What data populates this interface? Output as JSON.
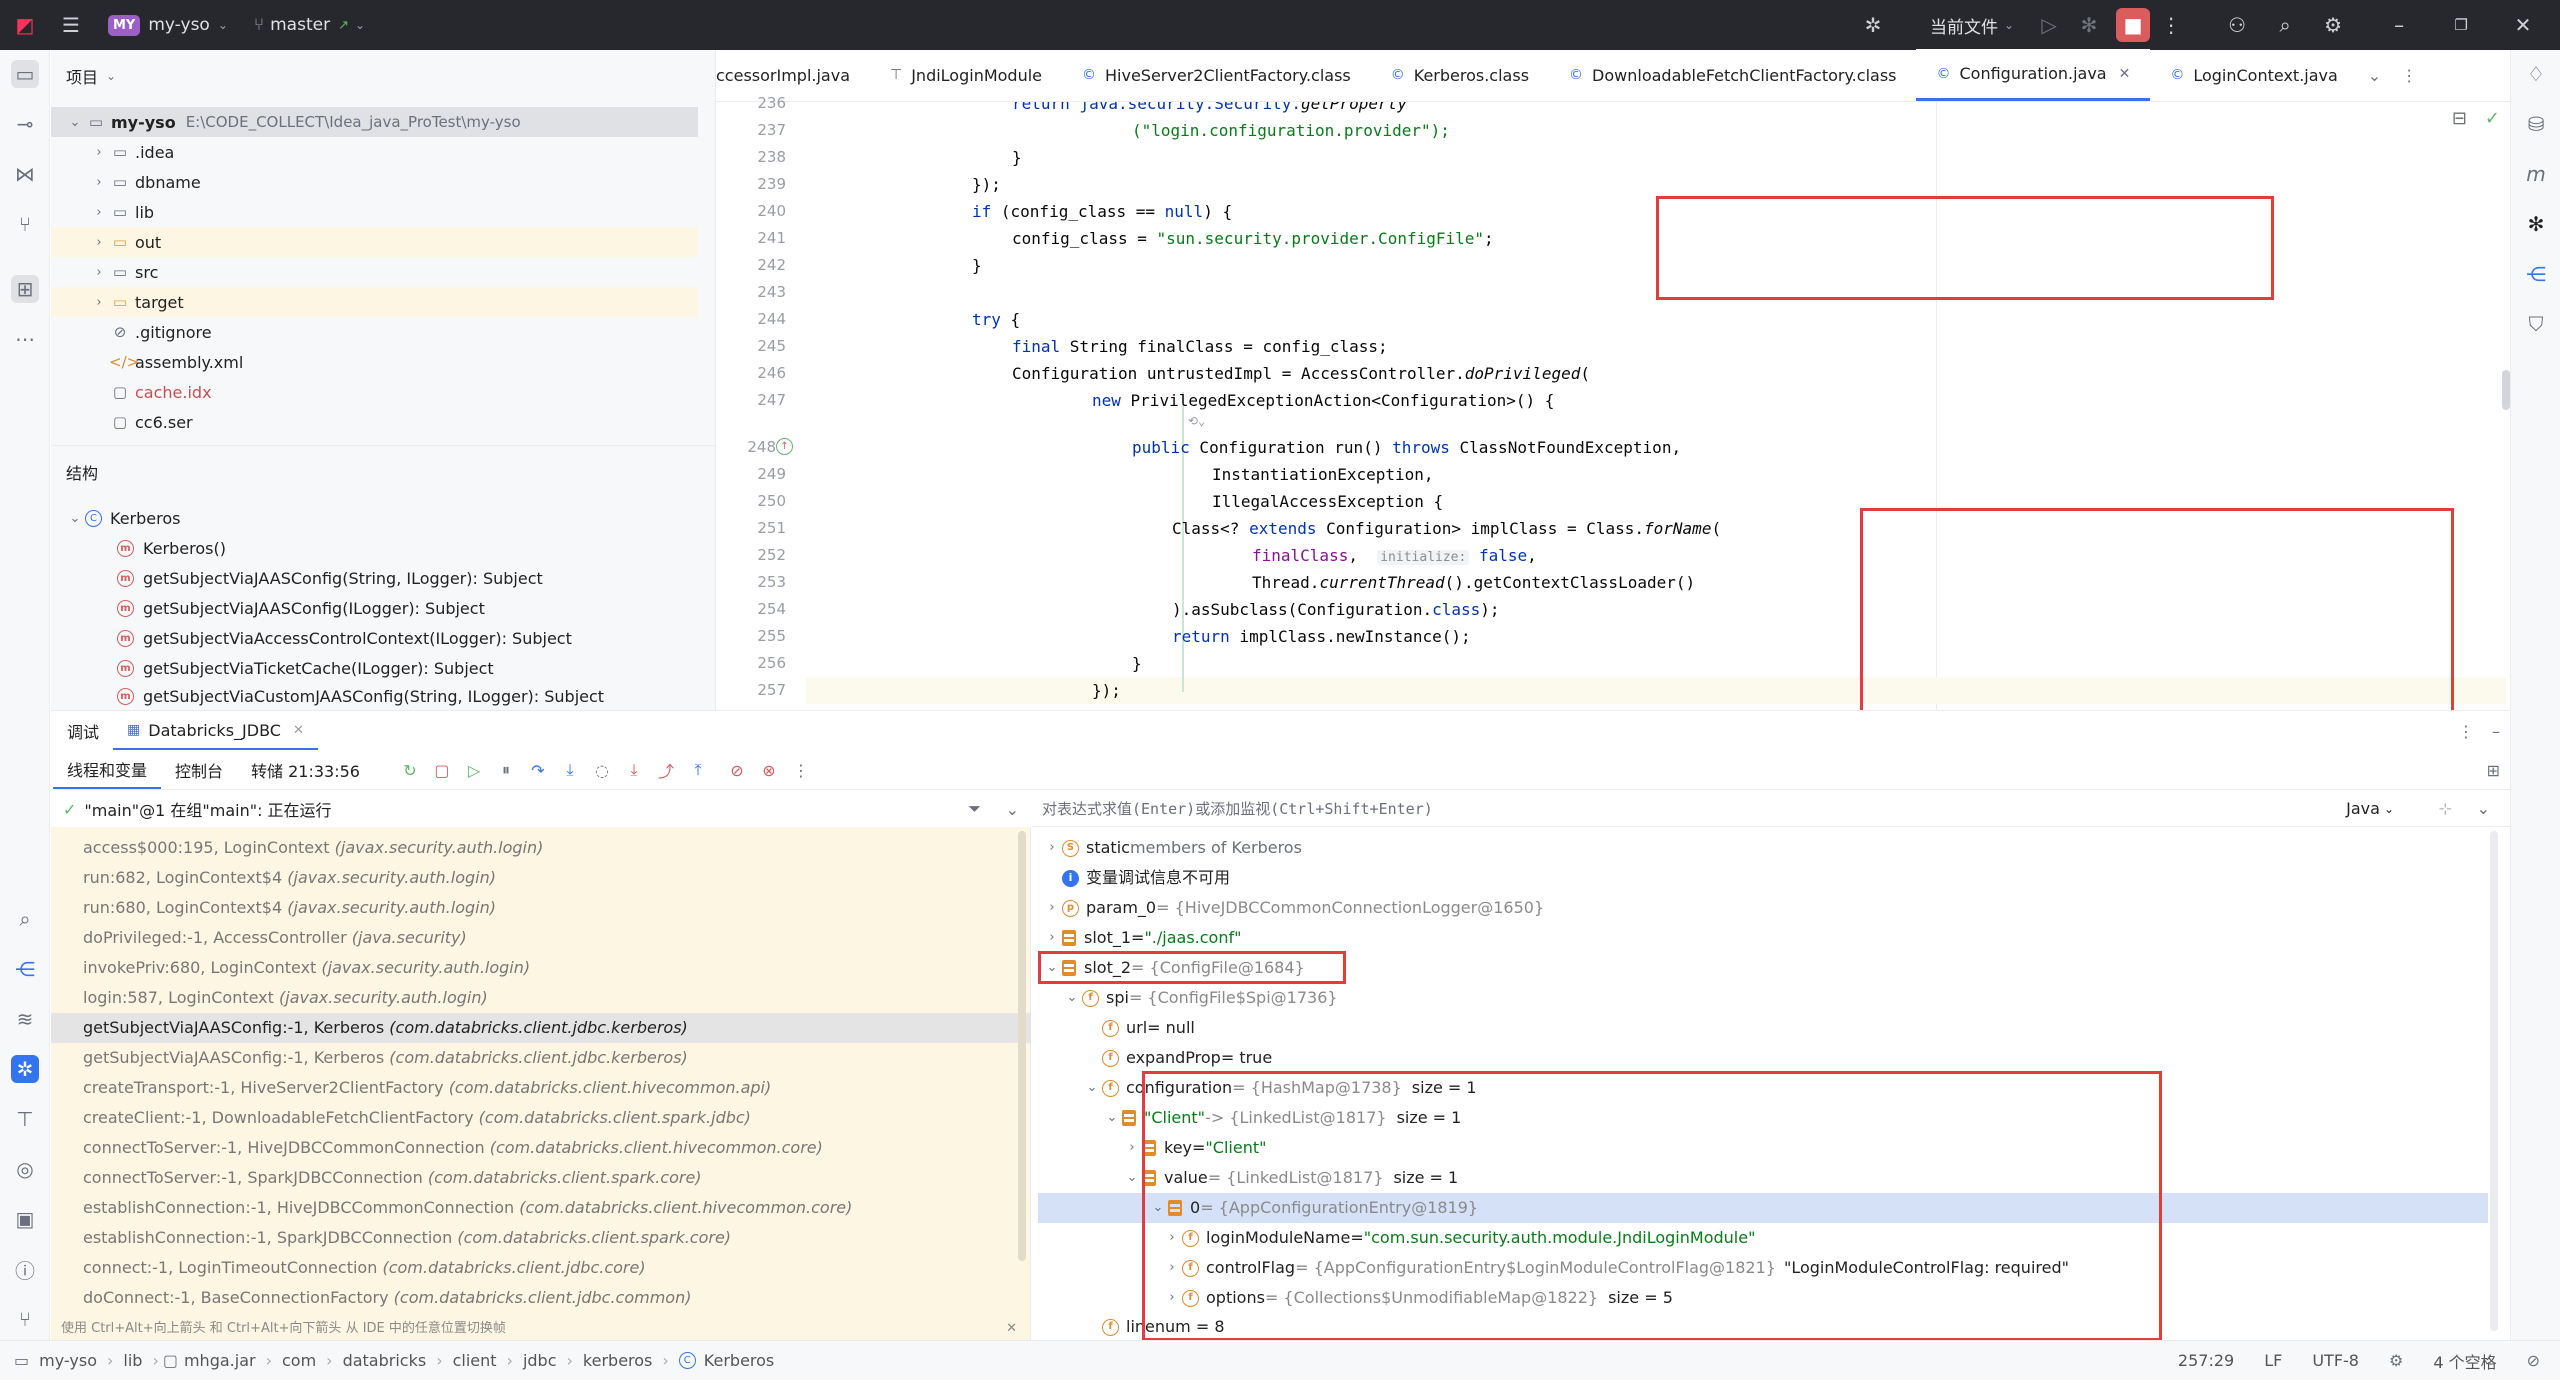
{
  "titlebar": {
    "project_badge": "MY",
    "project_name": "my-yso",
    "branch": "master",
    "run_config": "当前文件"
  },
  "project_panel": {
    "title": "项目",
    "root_name": "my-yso",
    "root_path": "E:\\CODE_COLLECT\\Idea_java_ProTest\\my-yso",
    "items": [
      {
        "label": ".idea"
      },
      {
        "label": "dbname"
      },
      {
        "label": "lib"
      },
      {
        "label": "out"
      },
      {
        "label": "src"
      },
      {
        "label": "target"
      },
      {
        "label": ".gitignore"
      },
      {
        "label": "assembly.xml"
      },
      {
        "label": "cache.idx"
      },
      {
        "label": "cc6.ser"
      }
    ]
  },
  "structure_panel": {
    "title": "结构",
    "class_name": "Kerberos",
    "members": [
      "Kerberos()",
      "getSubjectViaJAASConfig(String, ILogger): Subject",
      "getSubjectViaJAASConfig(ILogger): Subject",
      "getSubjectViaAccessControlContext(ILogger): Subject",
      "getSubjectViaTicketCache(ILogger): Subject",
      "getSubjectViaCustomJAASConfig(String, ILogger): Subject"
    ]
  },
  "editor_tabs": [
    "ccessorImpl.java",
    "JndiLoginModule",
    "HiveServer2ClientFactory.class",
    "Kerberos.class",
    "DownloadableFetchClientFactory.class",
    "Configuration.java",
    "LoginContext.java"
  ],
  "code": {
    "line_numbers": [
      "236",
      "237",
      "238",
      "239",
      "240",
      "241",
      "242",
      "243",
      "244",
      "245",
      "246",
      "247",
      "248",
      "249",
      "250",
      "251",
      "252",
      "253",
      "254",
      "255",
      "256",
      "257"
    ],
    "l236_a": "return java.security.Security.",
    "l236_b": "getProperty",
    "l237": "(\"login.configuration.provider\");",
    "l238": "}",
    "l239": "});",
    "l240_kw": "if",
    "l240_rest": " (config_class == ",
    "l240_null": "null",
    "l240_end": ") {",
    "l241_a": "config_class = ",
    "l241_str": "\"sun.security.provider.ConfigFile\"",
    "l241_end": ";",
    "l242": "}",
    "l244_kw": "try",
    "l244_end": " {",
    "l245_kw": "final",
    "l245_rest": " String finalClass = config_class;",
    "l246_a": "Configuration untrustedImpl = AccessController.",
    "l246_b": "doPrivileged",
    "l246_c": "(",
    "l247_kw": "new",
    "l247_rest": " PrivilegedExceptionAction<Configuration>() {",
    "l248_kw1": "public",
    "l248_a": " Configuration run() ",
    "l248_kw2": "throws",
    "l248_b": " ClassNotFoundException,",
    "l249": "InstantiationException,",
    "l250": "IllegalAccessException {",
    "l251_a": "Class<? ",
    "l251_kw": "extends",
    "l251_b": " Configuration> implClass = Class.",
    "l251_c": "forName",
    "l251_d": "(",
    "l252_fld": "finalClass",
    "l252_comma": ",",
    "l252_hint": "initialize:",
    "l252_false": "false",
    "l253_a": "Thread.",
    "l253_b": "currentThread",
    "l253_c": "().getContextClassLoader()",
    "l254_a": ").asSubclass(Configuration.",
    "l254_kw": "class",
    "l254_b": ");",
    "l255_kw": "return",
    "l255_rest": " implClass.newInstance();",
    "l256": "}",
    "l257": "});"
  },
  "debug": {
    "tab_debug": "调试",
    "session": "Databricks_JDBC",
    "sub_tabs": [
      "线程和变量",
      "控制台",
      "转储 21:33:56"
    ],
    "thread": "\"main\"@1 在组\"main\": 正在运行",
    "eval_placeholder": "对表达式求值(Enter)或添加监视(Ctrl+Shift+Enter)",
    "lang": "Java",
    "frames": [
      {
        "m": "access$000:195, LoginContext",
        "p": "(javax.security.auth.login)"
      },
      {
        "m": "run:682, LoginContext$4",
        "p": "(javax.security.auth.login)"
      },
      {
        "m": "run:680, LoginContext$4",
        "p": "(javax.security.auth.login)"
      },
      {
        "m": "doPrivileged:-1, AccessController",
        "p": "(java.security)"
      },
      {
        "m": "invokePriv:680, LoginContext",
        "p": "(javax.security.auth.login)"
      },
      {
        "m": "login:587, LoginContext",
        "p": "(javax.security.auth.login)"
      },
      {
        "m": "getSubjectViaJAASConfig:-1, Kerberos",
        "p": "(com.databricks.client.jdbc.kerberos)"
      },
      {
        "m": "getSubjectViaJAASConfig:-1, Kerberos",
        "p": "(com.databricks.client.jdbc.kerberos)"
      },
      {
        "m": "createTransport:-1, HiveServer2ClientFactory",
        "p": "(com.databricks.client.hivecommon.api)"
      },
      {
        "m": "createClient:-1, DownloadableFetchClientFactory",
        "p": "(com.databricks.client.spark.jdbc)"
      },
      {
        "m": "connectToServer:-1, HiveJDBCCommonConnection",
        "p": "(com.databricks.client.hivecommon.core)"
      },
      {
        "m": "connectToServer:-1, SparkJDBCConnection",
        "p": "(com.databricks.client.spark.core)"
      },
      {
        "m": "establishConnection:-1, HiveJDBCCommonConnection",
        "p": "(com.databricks.client.hivecommon.core)"
      },
      {
        "m": "establishConnection:-1, SparkJDBCConnection",
        "p": "(com.databricks.client.spark.core)"
      },
      {
        "m": "connect:-1, LoginTimeoutConnection",
        "p": "(com.databricks.client.jdbc.core)"
      },
      {
        "m": "doConnect:-1, BaseConnectionFactory",
        "p": "(com.databricks.client.jdbc.common)"
      }
    ],
    "frames_hint": "使用 Ctrl+Alt+向上箭头 和 Ctrl+Alt+向下箭头 从 IDE 中的任意位置切换帧",
    "vars": {
      "static_kw": "static",
      "static_rest": " members of Kerberos",
      "no_info": "变量调试信息不可用",
      "param0_name": "param_0",
      "param0_val": " = {HiveJDBCCommonConnectionLogger@1650}",
      "slot1_name": "slot_1",
      "slot1_eq": " = ",
      "slot1_val": "\"./jaas.conf\"",
      "slot2_name": "slot_2",
      "slot2_val": " = {ConfigFile@1684}",
      "spi_name": "spi",
      "spi_val": " = {ConfigFile$Spi@1736}",
      "url_name": "url",
      "url_val": " = null",
      "expand_name": "expandProp",
      "expand_val": " = true",
      "conf_name": "configuration",
      "conf_val": " = {HashMap@1738}",
      "conf_size": "size = 1",
      "client_name": "\"Client\"",
      "client_val": " -> {LinkedList@1817}",
      "client_size": "size = 1",
      "key_name": "key",
      "key_eq": " = ",
      "key_val": "\"Client\"",
      "value_name": "value",
      "value_val": " = {LinkedList@1817}",
      "value_size": "size = 1",
      "zero_name": "0",
      "zero_val": " = {AppConfigurationEntry@1819}",
      "lmn_name": "loginModuleName",
      "lmn_eq": " = ",
      "lmn_val": "\"com.sun.security.auth.module.JndiLoginModule\"",
      "cf_name": "controlFlag",
      "cf_val": " = {AppConfigurationEntry$LoginModuleControlFlag@1821}",
      "cf_str": "\"LoginModuleControlFlag: required\"",
      "opt_name": "options",
      "opt_val": " = {Collections$UnmodifiableMap@1822}",
      "opt_size": "size = 5",
      "linenum": "linenum = 8"
    }
  },
  "statusbar": {
    "crumbs": [
      "my-yso",
      "lib",
      "mhga.jar",
      "com",
      "databricks",
      "client",
      "jdbc",
      "kerberos",
      "Kerberos"
    ],
    "position": "257:29",
    "line_sep": "LF",
    "encoding": "UTF-8",
    "indent": "4 个空格"
  }
}
